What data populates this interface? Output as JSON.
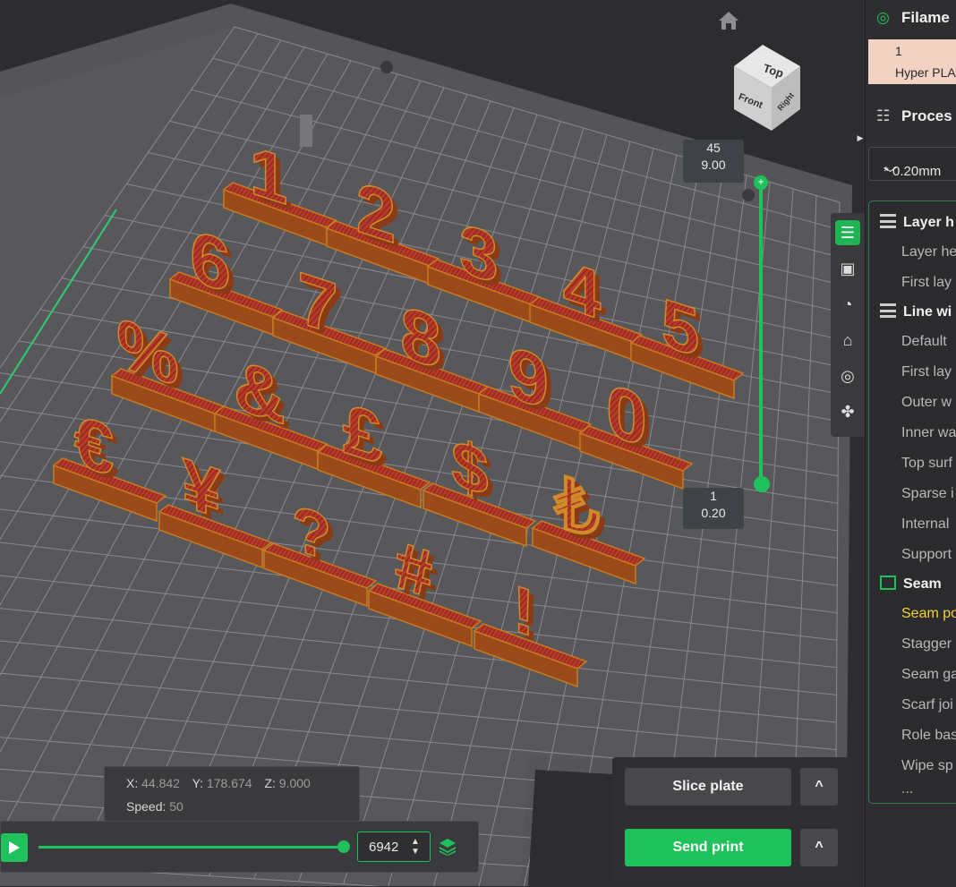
{
  "panel": {
    "filament_title": "Filame",
    "filament_slot_number": "1",
    "filament_slot_name": "Hyper PLA",
    "process_title": "Proces",
    "preset_value": "* 0.20mm",
    "groups": {
      "layer_height": "Layer h",
      "line_width": "Line wi",
      "seam": "Seam"
    },
    "rows": {
      "layer_height_row": "Layer he",
      "first_layer_height": "First lay",
      "default": "Default",
      "first_layer_width": "First lay",
      "outer_wall": "Outer w",
      "inner_wall": "Inner wa",
      "top_surface": "Top surf",
      "sparse_infill": "Sparse i",
      "internal": "Internal",
      "support": "Support",
      "seam_position": "Seam po",
      "staggered": "Stagger",
      "seam_gap": "Seam ga",
      "scarf_joint": "Scarf joi",
      "role_based": "Role bas",
      "wipe_speed": "Wipe sp",
      "more": "..."
    },
    "accent_color": "#1fc25a",
    "highlight_color": "#f5d23a"
  },
  "viewport": {
    "cube_faces": {
      "top": "Top",
      "front": "Front",
      "right": "Right"
    },
    "layer_slider": {
      "top_layer": "45",
      "top_height": "9.00",
      "bottom_layer": "1",
      "bottom_height": "0.20"
    },
    "glyphs": [
      "1",
      "2",
      "3",
      "4",
      "5",
      "6",
      "7",
      "8",
      "9",
      "0",
      "%",
      "&",
      "£",
      "€",
      "₺",
      "¥",
      "$",
      "?",
      "#",
      "!"
    ],
    "model_color": "#b83a2a",
    "model_edge_color": "#c67a22"
  },
  "coords": {
    "x_label": "X:",
    "x_value": "44.842",
    "y_label": "Y:",
    "y_value": "178.674",
    "z_label": "Z:",
    "z_value": "9.000",
    "speed_label": "Speed:",
    "speed_value": "50"
  },
  "playback": {
    "move_value": "6942"
  },
  "actions": {
    "slice_label": "Slice plate",
    "send_label": "Send print",
    "more_label": "^"
  }
}
